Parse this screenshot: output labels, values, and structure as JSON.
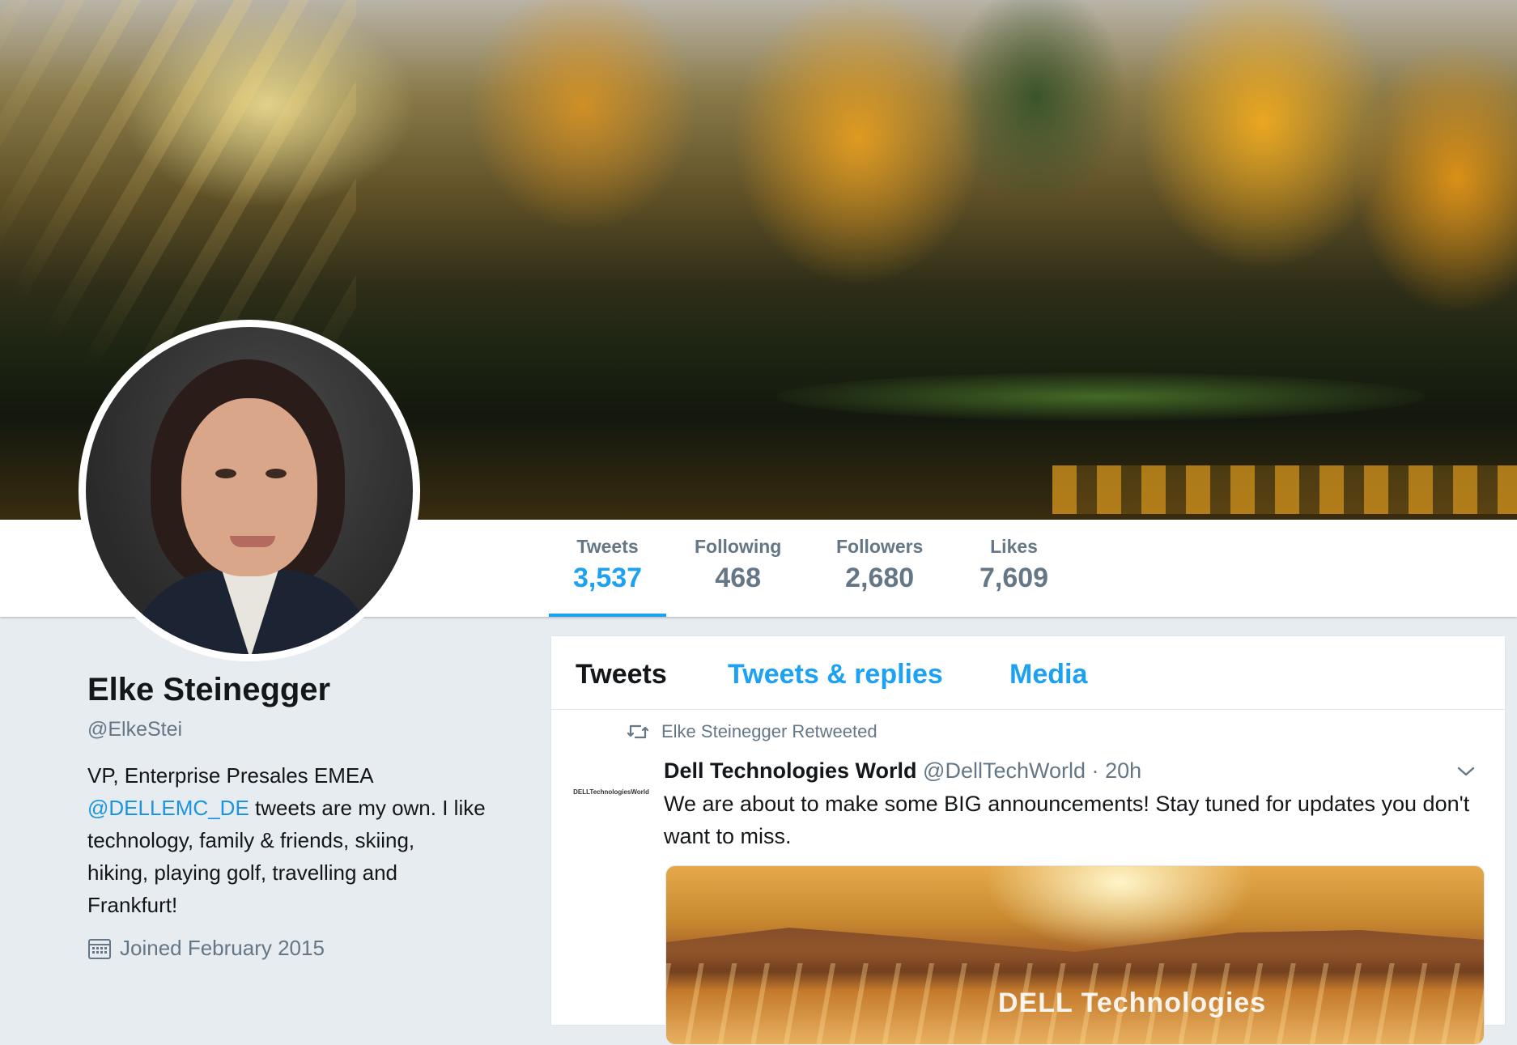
{
  "stats": [
    {
      "label": "Tweets",
      "value": "3,537"
    },
    {
      "label": "Following",
      "value": "468"
    },
    {
      "label": "Followers",
      "value": "2,680"
    },
    {
      "label": "Likes",
      "value": "7,609"
    }
  ],
  "profile": {
    "name": "Elke Steinegger",
    "handle": "@ElkeStei",
    "bio_line1": "VP, Enterprise Presales EMEA",
    "bio_mention": "@DELLEMC_DE",
    "bio_rest1": " tweets are my own. I like",
    "bio_line3": "technology, family & friends, skiing,",
    "bio_line4": "hiking, playing golf, travelling and",
    "bio_line5": "Frankfurt!",
    "joined": "Joined February 2015"
  },
  "timeline": {
    "tabs": [
      "Tweets",
      "Tweets & replies",
      "Media"
    ],
    "tweet": {
      "retweet_label": "Elke Steinegger Retweeted",
      "author_name": "Dell Technologies World",
      "author_handle": "@DellTechWorld",
      "separator": "·",
      "time": "20h",
      "text": "We are about to make some BIG announcements! Stay tuned for updates you don't want to miss.",
      "avatar_text": "DELLTechnologiesWorld",
      "media_logo_text": "DELL Technologies"
    }
  },
  "colors": {
    "accent": "#1da1f2",
    "muted": "#657786",
    "background": "#e6ecf0"
  },
  "icons": [
    "retweet-icon",
    "calendar-icon",
    "chevron-down-icon"
  ]
}
